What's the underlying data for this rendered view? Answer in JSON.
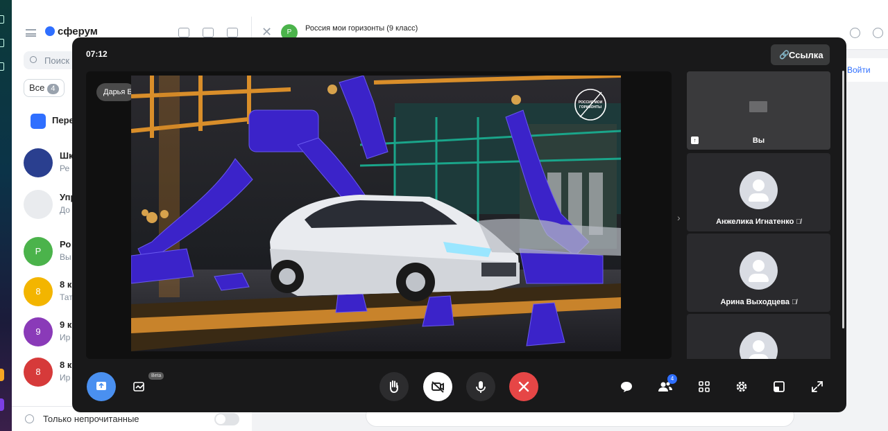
{
  "app": {
    "logo_text": "сферум"
  },
  "sidebar": {
    "search_placeholder": "Поиск",
    "filter": {
      "label": "Все",
      "count": "4"
    },
    "chats": [
      {
        "name": "Пере",
        "preview": "",
        "avatar": "",
        "color": "#2f6fff"
      },
      {
        "name": "Шк",
        "preview": "Ре",
        "avatar": "",
        "color": "#2a3f8f"
      },
      {
        "name": "Упр",
        "preview": "До",
        "avatar": "",
        "color": "#e9ebee"
      },
      {
        "name": "Ро",
        "preview": "Вы",
        "avatar": "Р",
        "color": "#4bb34b"
      },
      {
        "name": "8 к",
        "preview": "Тат",
        "avatar": "8",
        "color": "#f3b500"
      },
      {
        "name": "9 к",
        "preview": "Ир",
        "avatar": "9",
        "color": "#8a3ab8"
      },
      {
        "name": "8 к",
        "preview": "Ир",
        "avatar": "8",
        "color": "#d63a3a"
      }
    ],
    "footer_label": "Только непрочитанные"
  },
  "chat_header": {
    "title": "Россия мои горизонты (9 класс)",
    "avatar": "Р",
    "join_label": "Войти"
  },
  "call": {
    "timer": "07:12",
    "link_label": "Ссылка",
    "speaker_name": "Дарья Б",
    "video_logo_line1": "РОССИЯ МОИ",
    "video_logo_line2": "ГОРИЗОНТЫ",
    "participants": [
      {
        "name": "Вы",
        "muted": false,
        "screen": true
      },
      {
        "name": "Анжелика Игнатенко",
        "muted": true
      },
      {
        "name": "Арина Выходцева",
        "muted": true
      },
      {
        "name": "",
        "muted": false
      }
    ],
    "beta_label": "Beta",
    "participants_count": "4"
  },
  "icons": {
    "link": "link-icon",
    "mute": "mic-off-icon",
    "hand": "raise-hand-icon",
    "camera_off": "camera-off-icon",
    "mic": "mic-icon",
    "hangup": "hangup-icon",
    "chat": "chat-icon",
    "people": "participants-icon",
    "grid": "grid-icon",
    "settings": "gear-icon",
    "layout": "layout-icon",
    "fullscreen": "fullscreen-icon"
  },
  "colors": {
    "accent": "#2f6fff",
    "hangup": "#e64646",
    "call_bg": "#19191a"
  }
}
